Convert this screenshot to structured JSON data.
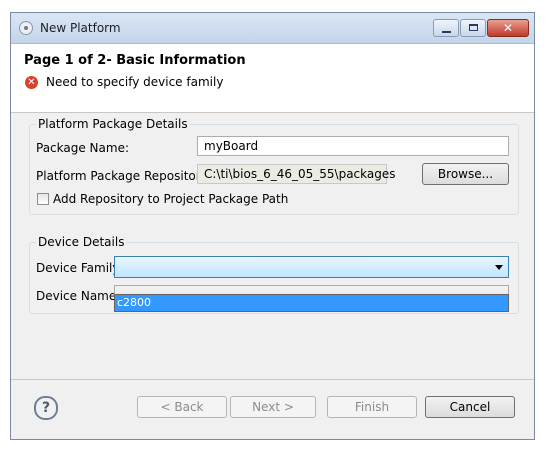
{
  "window": {
    "title": "New Platform"
  },
  "header": {
    "page_title": "Page 1 of 2- Basic Information",
    "error_message": "Need to specify device family"
  },
  "platform_group": {
    "label": "Platform Package Details",
    "package_name_label": "Package Name:",
    "package_name_value": "myBoard",
    "repository_label": "Platform Package Repository:",
    "repository_value": "C:\\ti\\bios_6_46_05_55\\packages",
    "browse_label": "Browse...",
    "add_repo_label": "Add Repository to Project Package Path",
    "add_repo_checked": false
  },
  "device_group": {
    "label": "Device Details",
    "family_label": "Device Family",
    "family_value": "",
    "name_label": "Device Name",
    "name_value": "",
    "dropdown_options": [
      "c2800"
    ]
  },
  "footer": {
    "back_label": "< Back",
    "next_label": "Next >",
    "finish_label": "Finish",
    "cancel_label": "Cancel"
  },
  "icons": {
    "app": "platform-icon",
    "error": "error-icon",
    "help": "help-icon"
  },
  "colors": {
    "selection": "#3399ff",
    "error": "#d9412a"
  }
}
